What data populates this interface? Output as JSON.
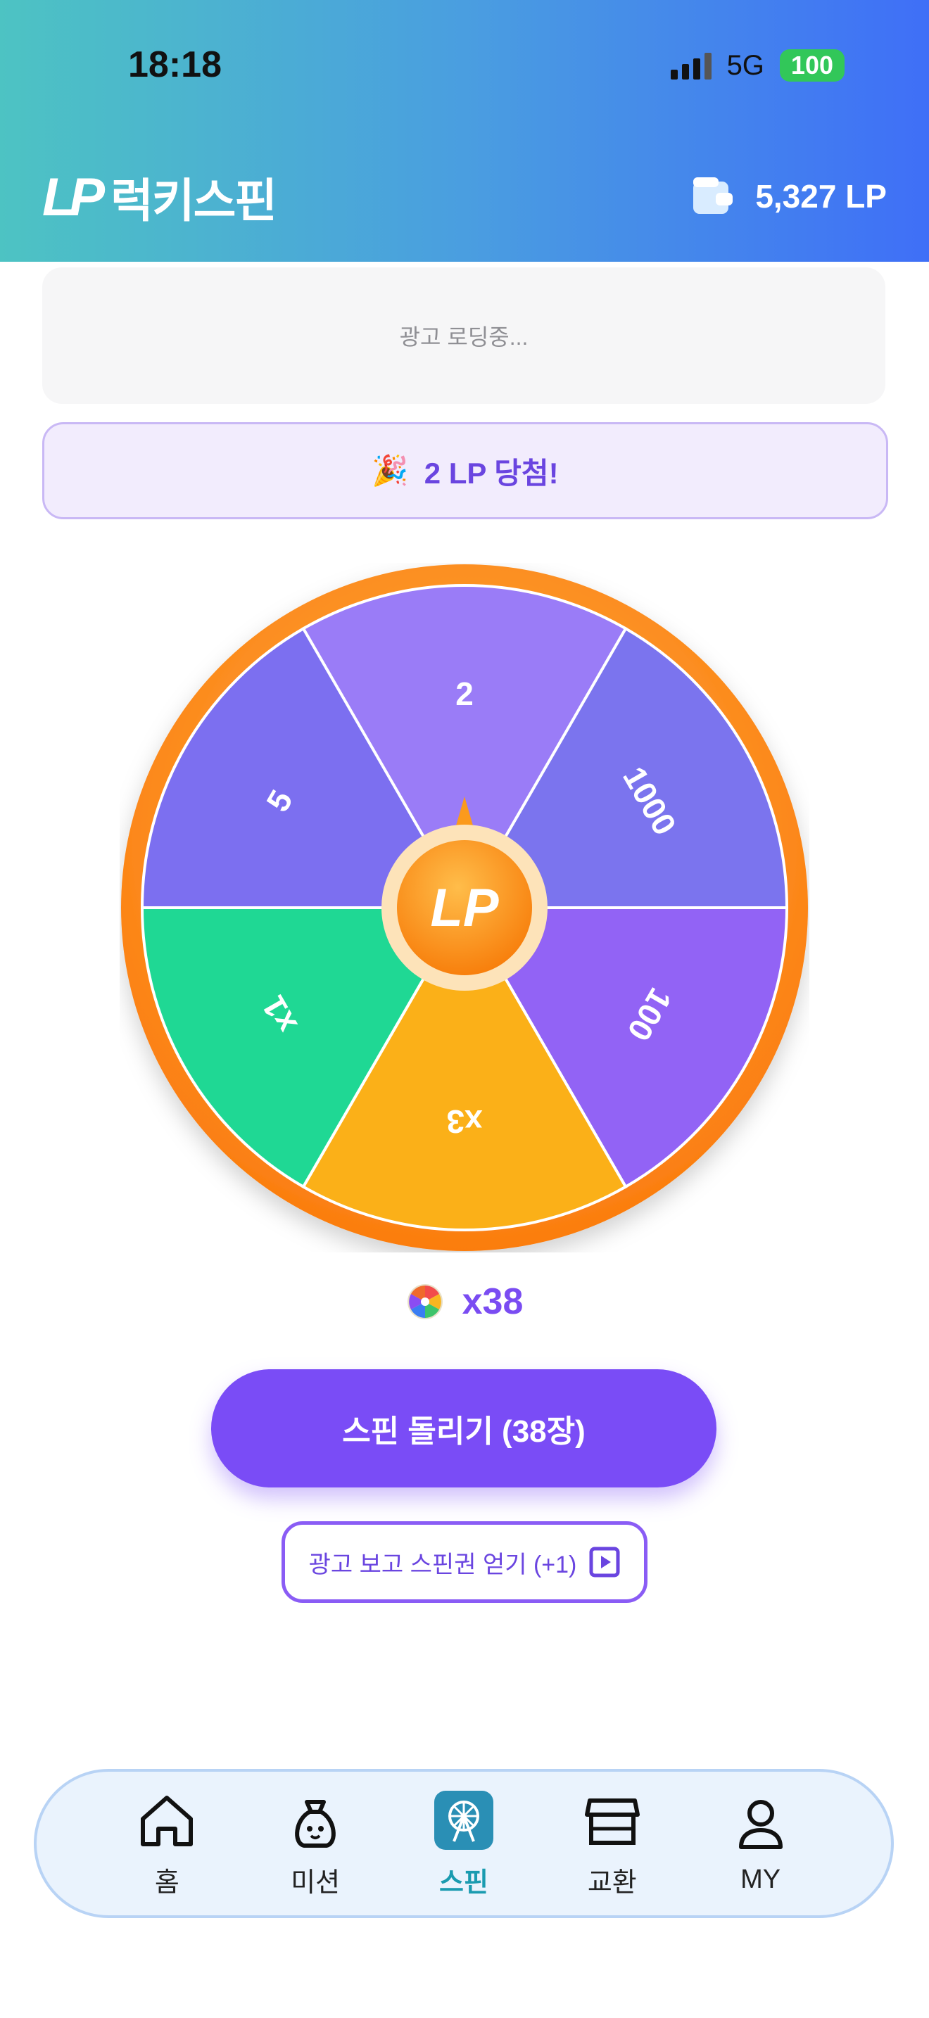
{
  "status": {
    "time": "18:18",
    "network": "5G",
    "battery": "100"
  },
  "header": {
    "logo": "LP",
    "title": "럭키스핀",
    "balance": "5,327 LP"
  },
  "ad": {
    "loading_text": "광고 로딩중..."
  },
  "result": {
    "emoji": "🎉",
    "text": "2 LP 당첨!"
  },
  "wheel": {
    "center_logo": "LP",
    "segments": [
      {
        "label": "2",
        "icon": "lp-logo",
        "color": "#9a7cf7"
      },
      {
        "label": "1000",
        "icon": "lp-logo",
        "color": "#7b74ee"
      },
      {
        "label": "100",
        "icon": "lp-logo",
        "color": "#9263f5"
      },
      {
        "label": "x3",
        "icon": "spin-ticket-icon",
        "color": "#fbb018"
      },
      {
        "label": "x1",
        "icon": "spin-ticket-icon",
        "color": "#1fd894"
      },
      {
        "label": "5",
        "icon": "lp-logo",
        "color": "#7c6ff0"
      }
    ],
    "rim_color": "#fb8a1a"
  },
  "tickets": {
    "count": "x38",
    "icon": "spin-ticket-icon"
  },
  "spin_button": {
    "label": "스핀 돌리기 (38장)"
  },
  "ad_ticket_button": {
    "label": "광고 보고 스핀권 얻기 (+1)",
    "icon": "play-ad-icon"
  },
  "nav": {
    "items": [
      {
        "label": "홈",
        "icon": "home-icon",
        "active": false
      },
      {
        "label": "미션",
        "icon": "mission-bag-icon",
        "active": false
      },
      {
        "label": "스핀",
        "icon": "ferris-wheel-icon",
        "active": true
      },
      {
        "label": "교환",
        "icon": "store-icon",
        "active": false
      },
      {
        "label": "MY",
        "icon": "person-icon",
        "active": false
      }
    ]
  },
  "colors": {
    "accent": "#7a4cf6",
    "header_start": "#4dc3c3",
    "header_end": "#3f6ff7",
    "active_nav": "#1a9bb0"
  }
}
